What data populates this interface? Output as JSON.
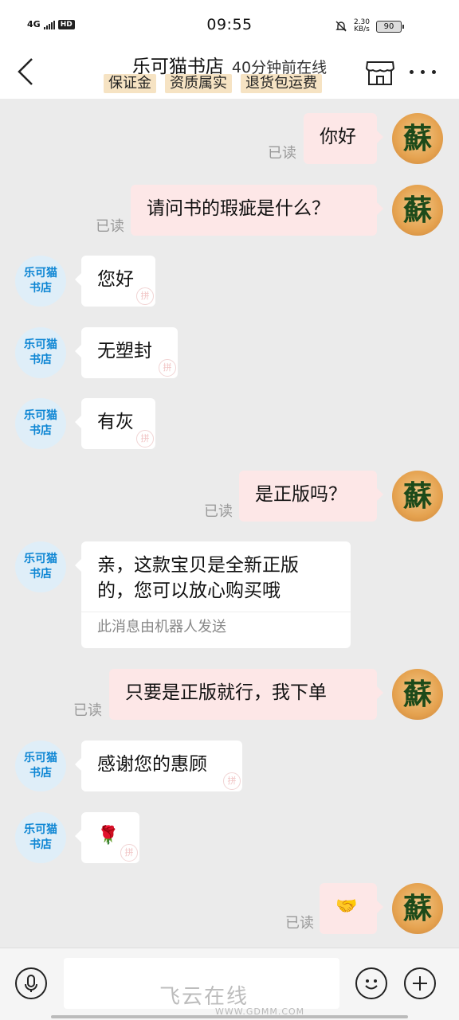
{
  "status_bar": {
    "network": "4G",
    "hd": "HD",
    "time": "09:55",
    "speed_value": "2.30",
    "speed_unit": "KB/s",
    "battery": "90"
  },
  "header": {
    "title": "乐可猫书店",
    "online_status": "40分钟前在线",
    "tags": [
      "保证金",
      "资质属实",
      "退货包运费"
    ]
  },
  "shop_avatar": {
    "line1": "乐可猫",
    "line2": "书店"
  },
  "my_avatar": {
    "glyph": "蘇"
  },
  "messages": [
    {
      "side": "right",
      "text": "你好",
      "read": "已读"
    },
    {
      "side": "right",
      "text": "请问书的瑕疵是什么？",
      "read": "已读"
    },
    {
      "side": "left",
      "text": "您好"
    },
    {
      "side": "left",
      "text": "无塑封"
    },
    {
      "side": "left",
      "text": "有灰"
    },
    {
      "side": "right",
      "text": "是正版吗？",
      "read": "已读"
    },
    {
      "side": "left",
      "text_line1": "亲，这款宝贝是全新正版",
      "text_line2": "的，您可以放心购买哦",
      "note": "此消息由机器人发送"
    },
    {
      "side": "right",
      "text": "只要是正版就行，我下单",
      "read": "已读"
    },
    {
      "side": "left",
      "text": "感谢您的惠顾"
    },
    {
      "side": "left",
      "emoji": "🌹"
    },
    {
      "side": "right",
      "emoji": "🤝",
      "read": "已读"
    }
  ],
  "watermark": {
    "text": "飞云在线",
    "url": "WWW.GDMM.COM"
  }
}
